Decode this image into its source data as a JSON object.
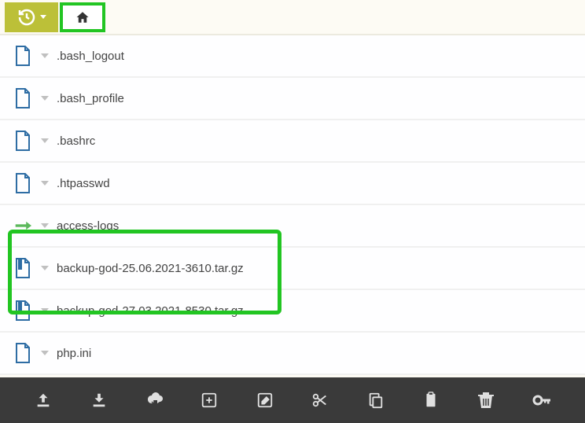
{
  "files": [
    {
      "name": ".bash_logout",
      "type": "file"
    },
    {
      "name": ".bash_profile",
      "type": "file"
    },
    {
      "name": ".bashrc",
      "type": "file"
    },
    {
      "name": ".htpasswd",
      "type": "file"
    },
    {
      "name": "access-logs",
      "type": "symlink"
    },
    {
      "name": "backup-god-25.06.2021-3610.tar.gz",
      "type": "archive"
    },
    {
      "name": "backup-god-27.03.2021-8530.tar.gz",
      "type": "archive"
    },
    {
      "name": "php.ini",
      "type": "file"
    }
  ],
  "colors": {
    "highlight": "#22c522",
    "olive": "#bcc038",
    "fileIcon": "#2e6da4",
    "symlink": "#5cb85c",
    "toolbar": "#3a3a3a"
  }
}
